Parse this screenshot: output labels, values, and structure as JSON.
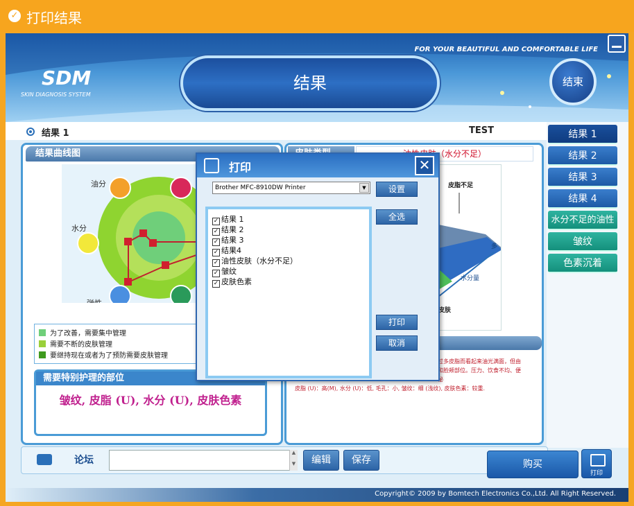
{
  "window": {
    "title": "打印结果"
  },
  "banner": {
    "slogan": "FOR YOUR BEAUTIFUL AND COMFORTABLE LIFE",
    "logo": "SDM",
    "logo_sub": "SKIN DIAGNOSIS SYSTEM",
    "page_title": "结果",
    "end_button": "结束"
  },
  "header": {
    "label": "结果 1",
    "user": "TEST"
  },
  "side_tabs": [
    {
      "label": "结果 1",
      "selected": true
    },
    {
      "label": "结果 2"
    },
    {
      "label": "结果 3"
    },
    {
      "label": "结果 4"
    },
    {
      "label": "水分不足的油性"
    },
    {
      "label": "皱纹"
    },
    {
      "label": "色素沉着"
    }
  ],
  "left_panel": {
    "section_title": "结果曲线图",
    "chart_labels": {
      "oil": "油分",
      "water": "水分",
      "elasticity": "弹性"
    },
    "legend": [
      {
        "text": "为了改善，需要集中管理",
        "color": "#6fcf7a"
      },
      {
        "text": "需要不断的皮肤管理",
        "color": "#9ad03a"
      },
      {
        "text": "要继持现在或者为了预防需要皮肤管理",
        "color": "#3e9a1e"
      }
    ],
    "special_title": "需要特别护理的部位",
    "special_value": "皱纹, 皮脂 (U), 水分 (U), 皮肤色素"
  },
  "right_panel": {
    "section_title": "皮肤类型",
    "type_value": "油性皮肤（水分不足）",
    "graph_labels": {
      "top": "皮脂不足",
      "axis": "水分量",
      "bottom": "皮肤",
      "side": "多"
    },
    "desc_lines": [
      "过多皮脂而看起来油光满面，但由",
      "和脸颊部位。压力、饮食不均、便",
      "秘"
    ],
    "summary": "皮脂 (U)：高(M), 水分 (U)：低, 毛孔：小, 皱纹：细 (浅纹), 皮肤色素：较重."
  },
  "bottom": {
    "forum": "论坛",
    "edit_button": "编辑",
    "save_button": "保存",
    "buy_button": "购买",
    "print_button": "打印"
  },
  "footer": {
    "copyright": "Copyright© 2009 by Bomtech Electronics Co.,Ltd.  All Right Reserved."
  },
  "dialog": {
    "title": "打印",
    "printer": "Brother MFC-8910DW Printer",
    "settings_button": "设置",
    "select_all_button": "全选",
    "print_button": "打印",
    "cancel_button": "取消",
    "items": [
      {
        "label": "结果 1",
        "checked": true
      },
      {
        "label": "结果 2",
        "checked": true
      },
      {
        "label": "结果 3",
        "checked": true
      },
      {
        "label": "结果4",
        "checked": true
      },
      {
        "label": "油性皮肤（水分不足）",
        "checked": true
      },
      {
        "label": "皱纹",
        "checked": true
      },
      {
        "label": "皮肤色素",
        "checked": true
      }
    ]
  }
}
